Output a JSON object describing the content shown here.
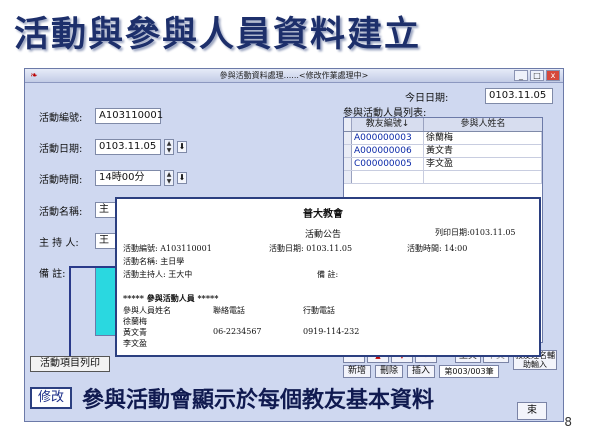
{
  "slide": {
    "title": "活動與參與人員資料建立",
    "caption": "參與活動會顯示於每個教友基本資料",
    "page_number": "8"
  },
  "window": {
    "title": "參與活動資料處理......<修改作業處理中>",
    "titlebar_buttons": [
      "_",
      "□",
      "x"
    ]
  },
  "form": {
    "today_label": "今日日期:",
    "today_value": "0103.11.05",
    "activity_id_label": "活動編號:",
    "activity_id_value": "A103110001",
    "activity_date_label": "活動日期:",
    "activity_date_value": "0103.11.05",
    "activity_time_label": "活動時間:",
    "activity_time_value": "14時00分",
    "activity_name_label": "活動名稱:",
    "activity_name_value": "主",
    "host_label": "主 持 人:",
    "host_value": "王",
    "notes_label": "備    註:"
  },
  "participants": {
    "list_label": "參與活動人員列表:",
    "columns": [
      "教友編號↓",
      "參與人姓名"
    ],
    "rows": [
      [
        "A000000003",
        "徐蘭梅"
      ],
      [
        "A000000006",
        "黃文青"
      ],
      [
        "C000000005",
        "李文盈"
      ]
    ]
  },
  "nav": {
    "up_label": "上頁",
    "down_label": "下頁",
    "add_label": "新增",
    "delete_label": "刪除",
    "insert_label": "插入",
    "counter": "第003/003筆",
    "input_helper": "教友姓名輔助輸入",
    "end_label": "束"
  },
  "report": {
    "org_name": "普大教會",
    "heading": "活動公告",
    "print_date": "列印日期:0103.11.05",
    "id_line": "活動編號: A103110001",
    "date_line": "活動日期: 0103.11.05",
    "time_line": "活動時間:  14:00",
    "name_line": "活動名稱: 主日學",
    "host_line": "活動主持人: 王大中",
    "notes_line": "備        註:",
    "section": "*****  參與活動人員  *****",
    "col_name": "參與人員姓名",
    "col_phone": "聯絡電話",
    "col_mobile": "行動電話",
    "people": [
      {
        "name": "徐蘭梅",
        "phone": "",
        "mobile": ""
      },
      {
        "name": "黃文青",
        "phone": "06-2234567",
        "mobile": "0919-114-232"
      },
      {
        "name": "李文盈",
        "phone": "",
        "mobile": ""
      }
    ]
  },
  "buttons": {
    "print_activity": "活動項目列印",
    "modify": "修改"
  }
}
